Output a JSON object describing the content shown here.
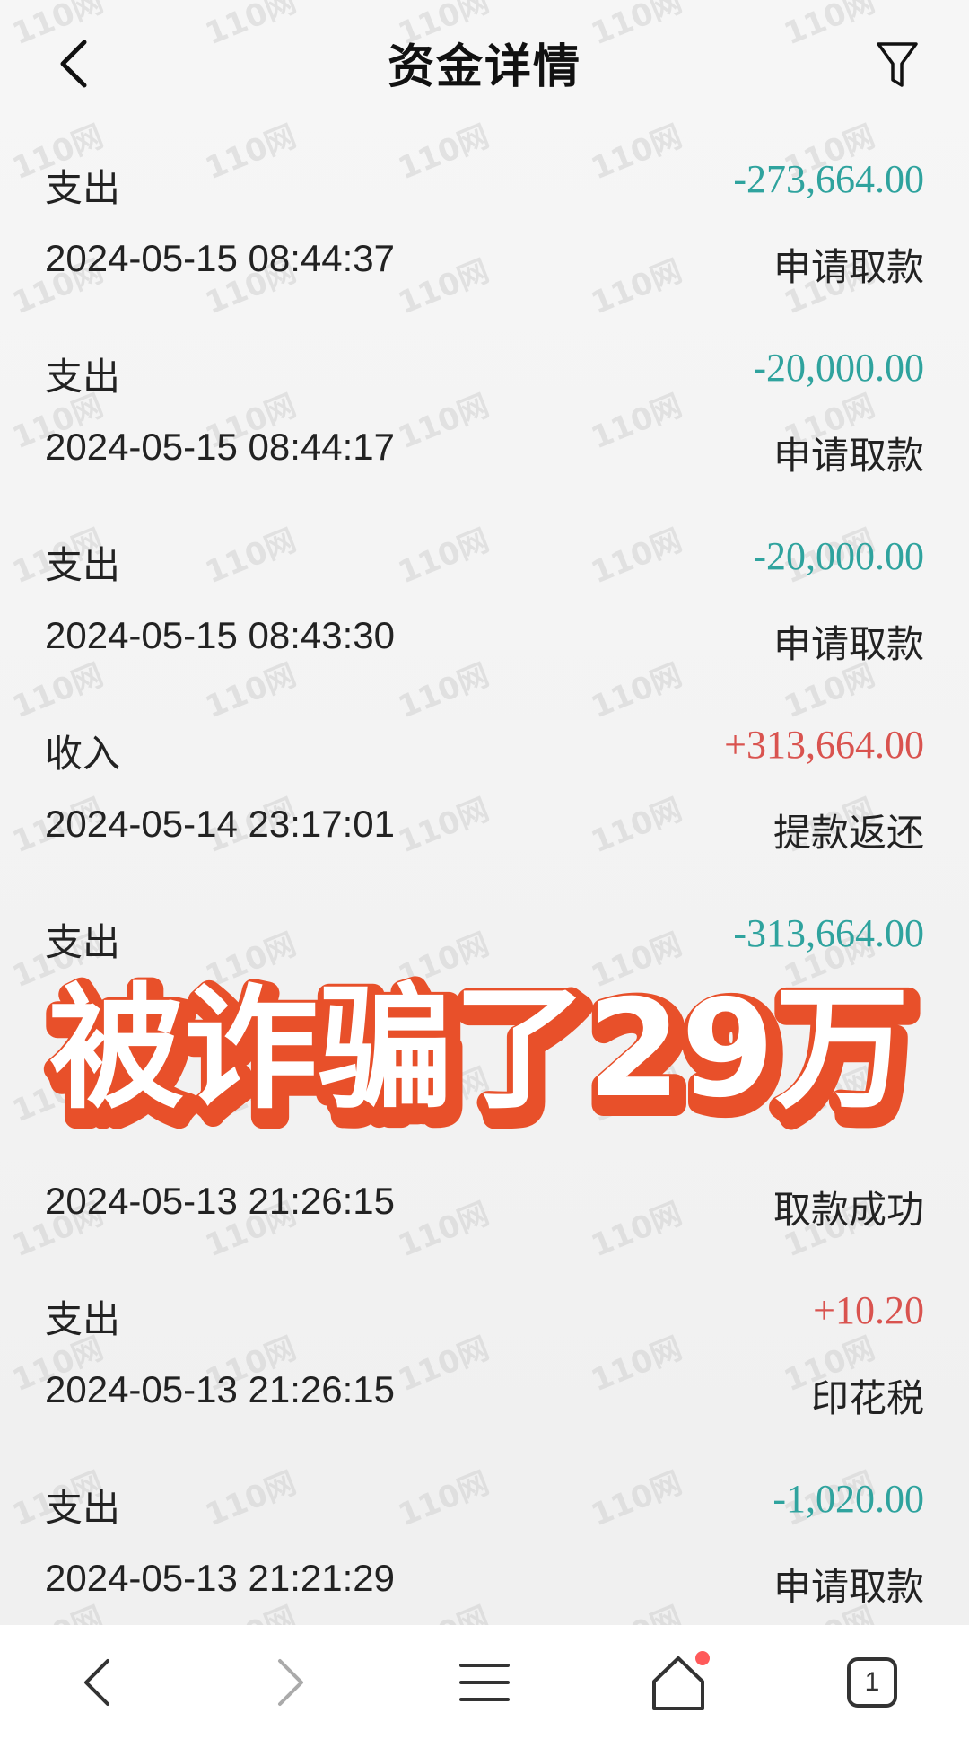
{
  "header": {
    "title": "资金详情"
  },
  "transactions": [
    {
      "type": "支出",
      "amount": "-273,664.00",
      "direction": "out",
      "time": "2024-05-15 08:44:37",
      "note": "申请取款"
    },
    {
      "type": "支出",
      "amount": "-20,000.00",
      "direction": "out",
      "time": "2024-05-15 08:44:17",
      "note": "申请取款"
    },
    {
      "type": "支出",
      "amount": "-20,000.00",
      "direction": "out",
      "time": "2024-05-15 08:43:30",
      "note": "申请取款"
    },
    {
      "type": "收入",
      "amount": "+313,664.00",
      "direction": "in",
      "time": "2024-05-14 23:17:01",
      "note": "提款返还"
    },
    {
      "type": "支出",
      "amount": "-313,664.00",
      "direction": "out",
      "time": "",
      "note": ""
    },
    {
      "type": "",
      "amount": "",
      "direction": "in",
      "time": "2024-05-13 21:26:15",
      "note": "取款成功"
    },
    {
      "type": "支出",
      "amount": "+10.20",
      "direction": "in",
      "time": "2024-05-13 21:26:15",
      "note": "印花税"
    },
    {
      "type": "支出",
      "amount": "-1,020.00",
      "direction": "out",
      "time": "2024-05-13 21:21:29",
      "note": "申请取款"
    }
  ],
  "overlay": {
    "caption": "被诈骗了29万"
  },
  "watermark": {
    "text": "110网"
  },
  "bottom_bar": {
    "tab_count": "1"
  },
  "colors": {
    "outflow": "#2fa39e",
    "inflow": "#d9534f",
    "caption_fill": "#ffffff",
    "caption_stroke": "#e8502a",
    "notification_dot": "#ff5a5a"
  }
}
